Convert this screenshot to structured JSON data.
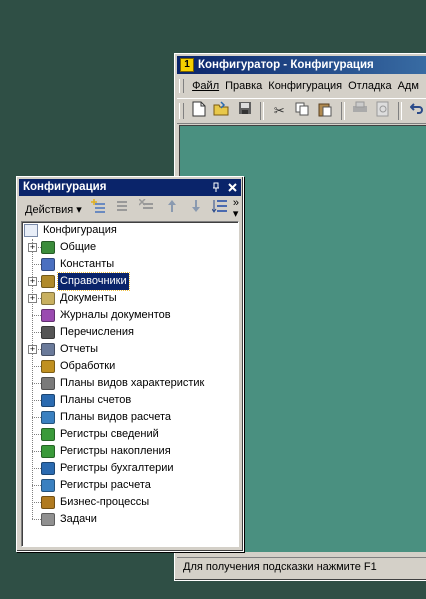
{
  "main_window": {
    "title": "Конфигуратор - Конфигурация",
    "menu": [
      "Файл",
      "Правка",
      "Конфигурация",
      "Отладка",
      "Адм"
    ],
    "status": "Для получения подсказки нажмите F1"
  },
  "panel": {
    "title": "Конфигурация",
    "pin": "↑",
    "close": "✕",
    "actions_label": "Действия",
    "actions_arrow": "▾",
    "more": "»"
  },
  "tree": {
    "root": "Конфигурация",
    "items": [
      {
        "label": "Общие",
        "icon": "general-icon",
        "expandable": true,
        "color": "#3b8c3b"
      },
      {
        "label": "Константы",
        "icon": "constants-icon",
        "expandable": false,
        "color": "#4a6fc0"
      },
      {
        "label": "Справочники",
        "icon": "catalogs-icon",
        "expandable": true,
        "selected": true,
        "color": "#b08a2a"
      },
      {
        "label": "Документы",
        "icon": "documents-icon",
        "expandable": true,
        "color": "#c8b060"
      },
      {
        "label": "Журналы документов",
        "icon": "document-journals-icon",
        "expandable": false,
        "color": "#9a4ab0"
      },
      {
        "label": "Перечисления",
        "icon": "enums-icon",
        "expandable": false,
        "color": "#555555"
      },
      {
        "label": "Отчеты",
        "icon": "reports-icon",
        "expandable": true,
        "color": "#6a7a9a"
      },
      {
        "label": "Обработки",
        "icon": "dataprocessors-icon",
        "expandable": false,
        "color": "#c09020"
      },
      {
        "label": "Планы видов характеристик",
        "icon": "chart-of-characteristics-icon",
        "expandable": false,
        "color": "#7a7a7a"
      },
      {
        "label": "Планы счетов",
        "icon": "chart-of-accounts-icon",
        "expandable": false,
        "color": "#2a6ab0"
      },
      {
        "label": "Планы видов расчета",
        "icon": "chart-of-calculation-icon",
        "expandable": false,
        "color": "#3a80c0"
      },
      {
        "label": "Регистры сведений",
        "icon": "information-registers-icon",
        "expandable": false,
        "color": "#3a9a3a"
      },
      {
        "label": "Регистры накопления",
        "icon": "accumulation-registers-icon",
        "expandable": false,
        "color": "#3a9a3a"
      },
      {
        "label": "Регистры бухгалтерии",
        "icon": "accounting-registers-icon",
        "expandable": false,
        "color": "#2a6ab0"
      },
      {
        "label": "Регистры расчета",
        "icon": "calculation-registers-icon",
        "expandable": false,
        "color": "#3a80c0"
      },
      {
        "label": "Бизнес-процессы",
        "icon": "business-processes-icon",
        "expandable": false,
        "color": "#b07a20"
      },
      {
        "label": "Задачи",
        "icon": "tasks-icon",
        "expandable": false,
        "color": "#909090"
      }
    ]
  }
}
